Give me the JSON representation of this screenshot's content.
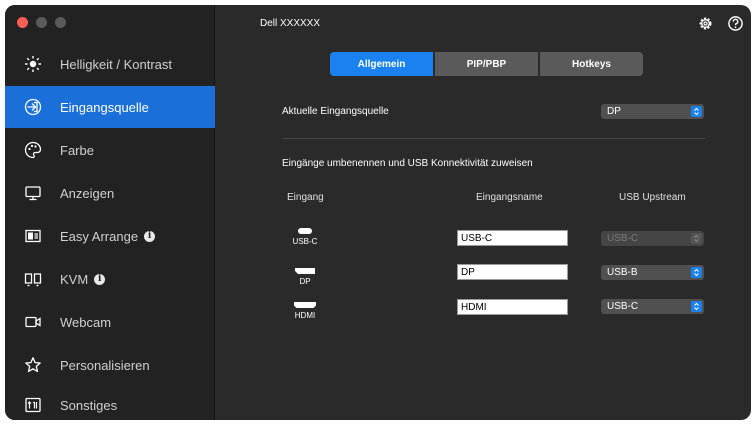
{
  "window": {
    "title": "Dell XXXXXX"
  },
  "sidebar": {
    "items": [
      {
        "label": "Helligkeit / Kontrast",
        "icon": "brightness-icon",
        "active": false,
        "info": false
      },
      {
        "label": "Eingangsquelle",
        "icon": "input-source-icon",
        "active": true,
        "info": false
      },
      {
        "label": "Farbe",
        "icon": "color-palette-icon",
        "active": false,
        "info": false
      },
      {
        "label": "Anzeigen",
        "icon": "display-icon",
        "active": false,
        "info": false
      },
      {
        "label": "Easy Arrange",
        "icon": "layout-icon",
        "active": false,
        "info": true
      },
      {
        "label": "KVM",
        "icon": "kvm-icon",
        "active": false,
        "info": true
      },
      {
        "label": "Webcam",
        "icon": "webcam-icon",
        "active": false,
        "info": false
      },
      {
        "label": "Personalisieren",
        "icon": "star-icon",
        "active": false,
        "info": false
      },
      {
        "label": "Sonstiges",
        "icon": "others-icon",
        "active": false,
        "info": false
      }
    ],
    "info_glyph": "i"
  },
  "tabs": [
    {
      "label": "Allgemein",
      "active": true
    },
    {
      "label": "PIP/PBP",
      "active": false
    },
    {
      "label": "Hotkeys",
      "active": false
    }
  ],
  "current_source": {
    "label": "Aktuelle Eingangsquelle",
    "value": "DP"
  },
  "rename_section": {
    "heading": "Eingänge umbenennen und USB Konnektivität zuweisen",
    "col_input": "Eingang",
    "col_name": "Eingangsname",
    "col_usb": "USB Upstream",
    "rows": [
      {
        "port": "USB-C",
        "name": "USB-C",
        "usb": "USB-C",
        "usb_enabled": false
      },
      {
        "port": "DP",
        "name": "DP",
        "usb": "USB-B",
        "usb_enabled": true
      },
      {
        "port": "HDMI",
        "name": "HDMI",
        "usb": "USB-C",
        "usb_enabled": true
      }
    ]
  },
  "colors": {
    "accent": "#1a82f0",
    "sidebar_active": "#1a6fd9",
    "background": "#2a2a2a",
    "sidebar_bg": "#222222"
  }
}
